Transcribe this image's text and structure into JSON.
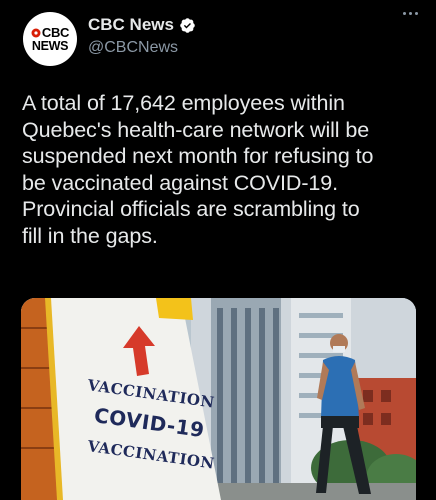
{
  "account": {
    "avatar_line1": "CBC",
    "avatar_line2": "NEWS",
    "display_name": "CBC News",
    "handle": "@CBCNews",
    "verified": true
  },
  "tweet": {
    "text": "A total of 17,642 employees within\nQuebec's health-care network will be\nsuspended next month for refusing to\nbe vaccinated against COVID-19.\nProvincial officials are scrambling to\nfill in the gaps."
  },
  "media": {
    "sign_line1": "VACCINATION",
    "sign_line2": "COVID-19",
    "sign_line3": "VACCINATION"
  },
  "icons": {
    "more": "more-options-icon",
    "verified": "verified-badge-icon",
    "arrow": "arrow-up-icon"
  },
  "colors": {
    "background": "#000000",
    "text": "#e7e9ea",
    "secondary_text": "#8b98a5",
    "verified": "#ffffff",
    "sign_red": "#d63a2a",
    "sign_blue": "#1f2a5a"
  }
}
